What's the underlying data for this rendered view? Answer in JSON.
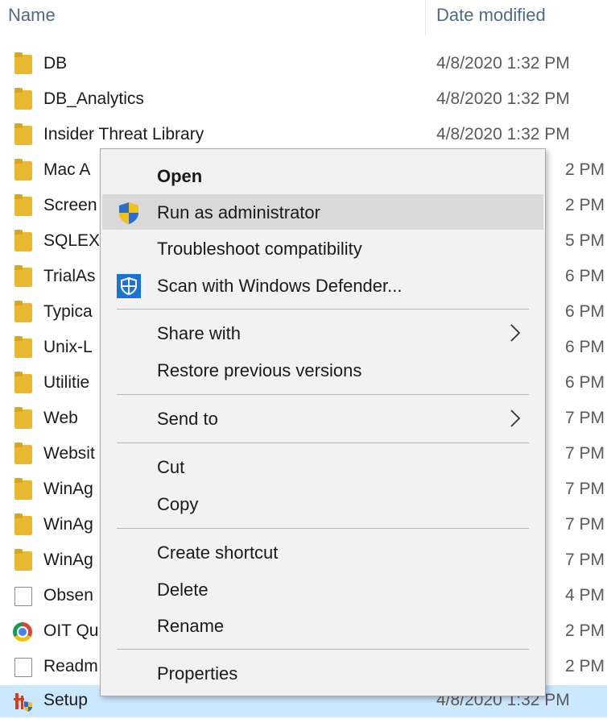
{
  "columns": {
    "name": "Name",
    "date_modified": "Date modified"
  },
  "files": [
    {
      "name": "DB",
      "date": "4/8/2020 1:32 PM",
      "icon": "folder-icon"
    },
    {
      "name": "DB_Analytics",
      "date": "4/8/2020 1:32 PM",
      "icon": "folder-icon"
    },
    {
      "name": "Insider Threat Library",
      "date": "4/8/2020 1:32 PM",
      "icon": "folder-icon"
    },
    {
      "name": "Mac A",
      "date": "2 PM",
      "icon": "folder-icon"
    },
    {
      "name": "Screen",
      "date": "2 PM",
      "icon": "folder-icon"
    },
    {
      "name": "SQLEX",
      "date": "5 PM",
      "icon": "folder-icon"
    },
    {
      "name": "TrialAs",
      "date": "6 PM",
      "icon": "folder-icon"
    },
    {
      "name": "Typica",
      "date": "6 PM",
      "icon": "folder-icon"
    },
    {
      "name": "Unix-L",
      "date": "6 PM",
      "icon": "folder-icon"
    },
    {
      "name": "Utilitie",
      "date": "6 PM",
      "icon": "folder-icon"
    },
    {
      "name": "Web",
      "date": "7 PM",
      "icon": "folder-icon"
    },
    {
      "name": "Websit",
      "date": "7 PM",
      "icon": "folder-icon"
    },
    {
      "name": "WinAg",
      "date": "7 PM",
      "icon": "folder-icon"
    },
    {
      "name": "WinAg",
      "date": "7 PM",
      "icon": "folder-icon"
    },
    {
      "name": "WinAg",
      "date": "7 PM",
      "icon": "folder-icon"
    },
    {
      "name": "Obsen",
      "date": "4 PM",
      "icon": "document-icon"
    },
    {
      "name": "OIT Qu",
      "date": "2 PM",
      "icon": "chrome-icon"
    },
    {
      "name": "Readm",
      "date": "2 PM",
      "icon": "document-icon"
    },
    {
      "name": "Setup",
      "date": "4/8/2020 1:32 PM",
      "icon": "setup-icon",
      "selected": true
    }
  ],
  "context_menu": {
    "open": "Open",
    "run_as_admin": "Run as administrator",
    "troubleshoot": "Troubleshoot compatibility",
    "scan_defender": "Scan with Windows Defender...",
    "share_with": "Share with",
    "restore_versions": "Restore previous versions",
    "send_to": "Send to",
    "cut": "Cut",
    "copy": "Copy",
    "create_shortcut": "Create shortcut",
    "delete": "Delete",
    "rename": "Rename",
    "properties": "Properties",
    "hovered_item": "Run as administrator"
  },
  "colors": {
    "folder": "#e8b830",
    "selection": "#cce8ff",
    "menu_background": "#f2f2f2",
    "menu_hover": "#d9d9d9",
    "header_text": "#4d6a8a",
    "defender_blue": "#1a73d8"
  }
}
